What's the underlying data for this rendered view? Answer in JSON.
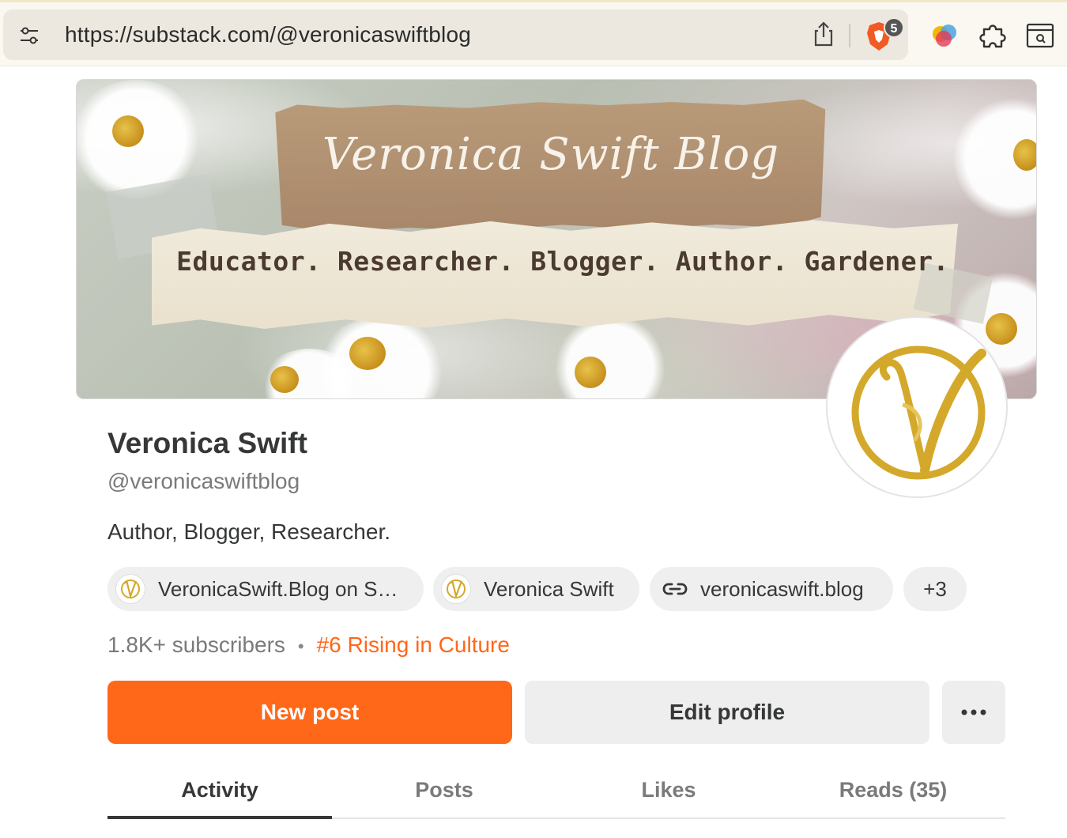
{
  "browser": {
    "url": "https://substack.com/@veronicaswiftblog",
    "brave_badge_count": "5",
    "icons": [
      "tune-icon",
      "share-icon",
      "brave-shield-icon",
      "extension-icon",
      "puzzle-icon",
      "reader-mode-icon"
    ]
  },
  "banner": {
    "title": "Veronica Swift Blog",
    "tagline": "Educator. Researcher. Blogger. Author. Gardener."
  },
  "profile": {
    "name": "Veronica Swift",
    "handle": "@veronicaswiftblog",
    "bio": "Author, Blogger, Researcher.",
    "avatar_letter": "V",
    "brand_color": "#d4a82a"
  },
  "chips": [
    {
      "label": "VeronicaSwift.Blog on S…",
      "icon": "v-logo-icon"
    },
    {
      "label": "Veronica Swift",
      "icon": "v-logo-icon"
    },
    {
      "label": "veronicaswift.blog",
      "icon": "link-icon"
    },
    {
      "label": "+3"
    }
  ],
  "stats": {
    "subscribers": "1.8K+ subscribers",
    "separator": "•",
    "rank": "#6 Rising in Culture"
  },
  "actions": {
    "new_post": "New post",
    "edit_profile": "Edit profile",
    "more": "more-options-icon"
  },
  "tabs": [
    {
      "label": "Activity",
      "active": true
    },
    {
      "label": "Posts",
      "active": false
    },
    {
      "label": "Likes",
      "active": false
    },
    {
      "label": "Reads (35)",
      "active": false
    }
  ],
  "colors": {
    "accent": "#ff6719",
    "chip_bg": "#efefef",
    "text_primary": "#363737",
    "text_secondary": "#7a7a7a"
  }
}
